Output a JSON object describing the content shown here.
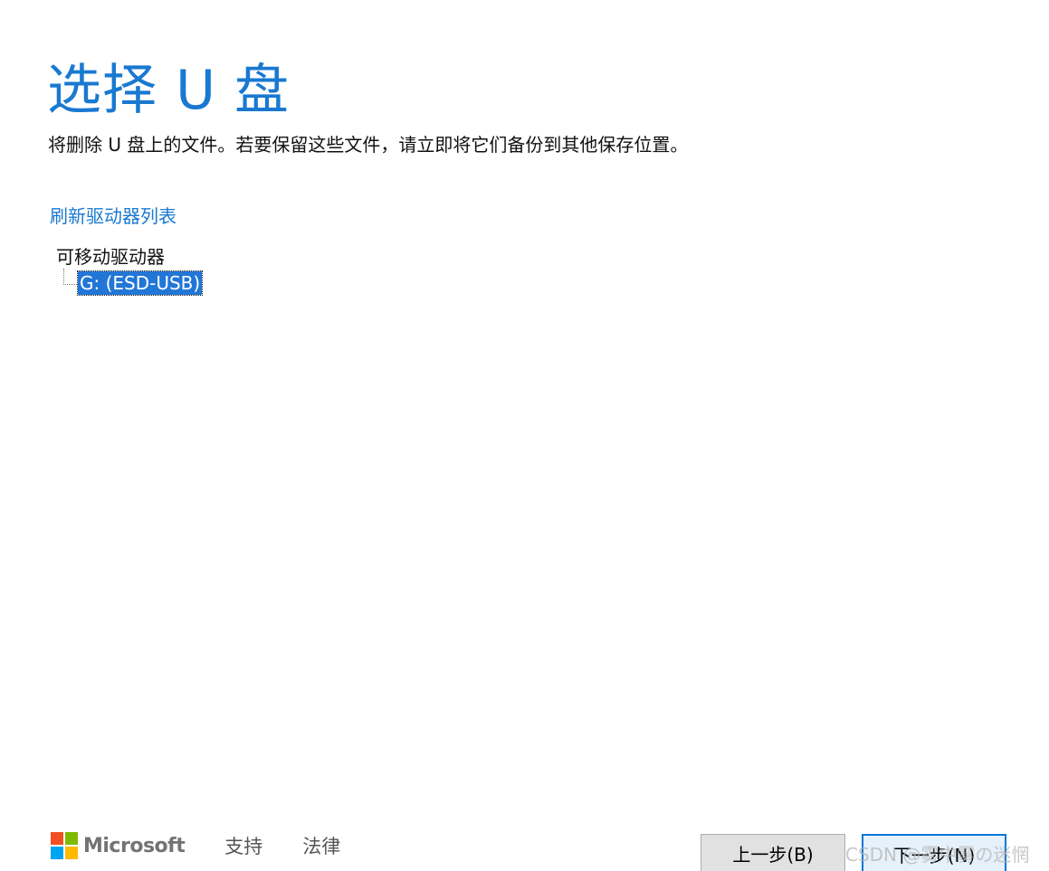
{
  "header": {
    "title": "选择 U 盘",
    "subtitle": "将删除 U 盘上的文件。若要保留这些文件，请立即将它们备份到其他保存位置。"
  },
  "refresh_link": "刷新驱动器列表",
  "drive_tree": {
    "root_label": "可移动驱动器",
    "items": [
      {
        "label": "G: (ESD-USB)",
        "selected": true
      }
    ]
  },
  "footer": {
    "brand": "Microsoft",
    "logo_colors": [
      "#f25022",
      "#7fba00",
      "#00a4ef",
      "#ffb900"
    ],
    "links": [
      "支持",
      "法律"
    ]
  },
  "buttons": {
    "back": "上一步(B)",
    "next": "下一步(N)"
  },
  "watermark": "CSDN @雾中雾の迷惘",
  "colors": {
    "accent": "#1979d1",
    "selection": "#2276d6"
  }
}
